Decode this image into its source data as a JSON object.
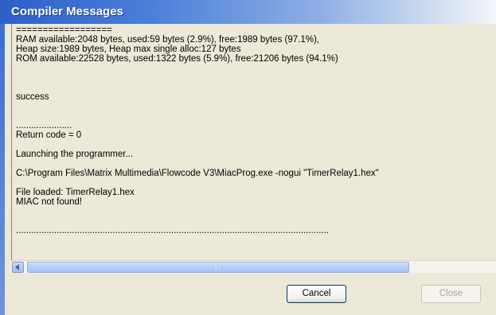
{
  "window": {
    "title": "Compiler Messages"
  },
  "output": {
    "lines": [
      "==================",
      "RAM available:2048 bytes, used:59 bytes (2.9%), free:1989 bytes (97.1%),",
      "Heap size:1989 bytes, Heap max single alloc:127 bytes",
      "ROM available:22528 bytes, used:1322 bytes (5.9%), free:21206 bytes (94.1%)",
      "",
      "",
      "",
      "success",
      "",
      "",
      "......................",
      "Return code = 0",
      "",
      "Launching the programmer...",
      "",
      "C:\\Program Files\\Matrix Multimedia\\Flowcode V3\\MiacProg.exe -nogui \"TimerRelay1.hex\"",
      "",
      "File loaded: TimerRelay1.hex",
      "MIAC not found!",
      "",
      "",
      "..........................................................................................................................."
    ]
  },
  "scrollbar": {
    "left_arrow_icon": "scroll-left-arrow-icon"
  },
  "buttons": {
    "cancel_label": "Cancel",
    "close_label": "Close",
    "close_enabled": false
  },
  "colors": {
    "title_bar": "#2c5fc8",
    "dialog_bg": "#ece9d8",
    "disabled_text": "#aca899"
  }
}
